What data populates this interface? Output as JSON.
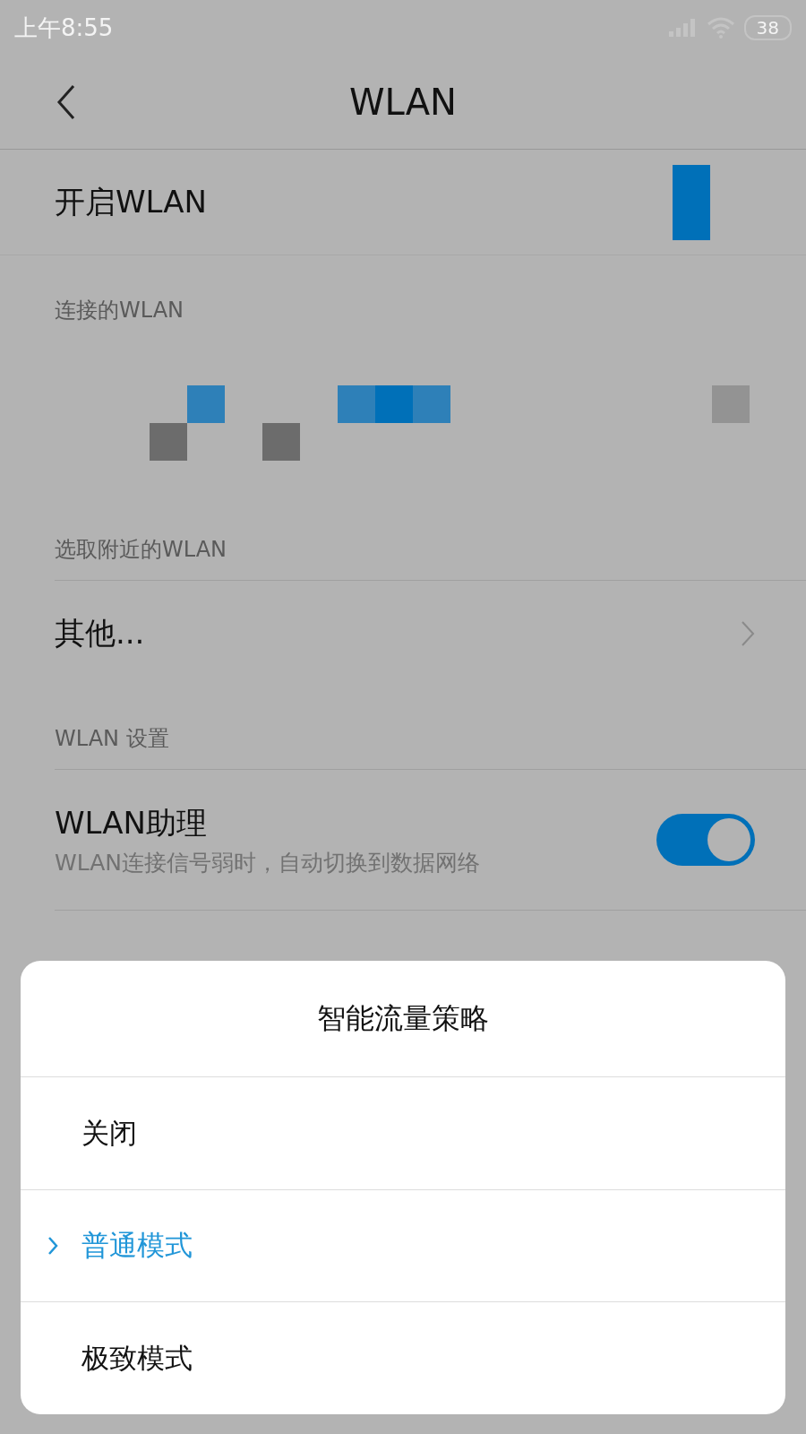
{
  "status_bar": {
    "time": "上午8:55",
    "battery": "38"
  },
  "header": {
    "title": "WLAN"
  },
  "wlan_switch": {
    "label": "开启WLAN"
  },
  "connected": {
    "heading": "连接的WLAN"
  },
  "nearby": {
    "heading": "选取附近的WLAN",
    "items": [
      {
        "label": "其他..."
      }
    ]
  },
  "settings": {
    "heading": "WLAN 设置",
    "items": [
      {
        "kind": "toggle",
        "label": "WLAN助理",
        "description": "WLAN连接信号弱时，自动切换到数据网络",
        "on": true
      }
    ]
  },
  "dialog": {
    "title": "智能流量策略",
    "options": [
      {
        "label": "关闭",
        "selected": false
      },
      {
        "label": "普通模式",
        "selected": true
      },
      {
        "label": "极致模式",
        "selected": false
      }
    ]
  }
}
